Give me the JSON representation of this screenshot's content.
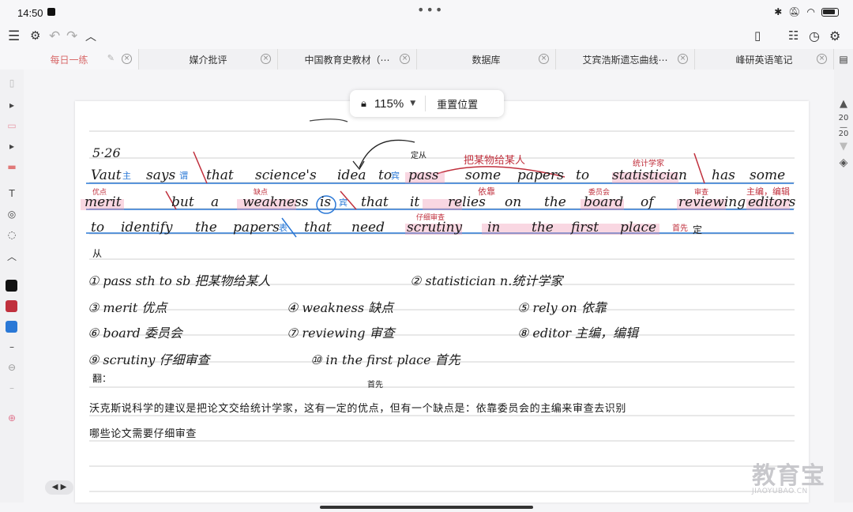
{
  "status": {
    "time": "14:50"
  },
  "tabs": [
    {
      "label": "每日一练"
    },
    {
      "label": "媒介批评"
    },
    {
      "label": "中国教育史教材（⋯"
    },
    {
      "label": "数据库"
    },
    {
      "label": "艾宾浩斯遗忘曲线⋯"
    },
    {
      "label": "峰研英语笔记"
    }
  ],
  "zoom": {
    "value": "115%",
    "reset_label": "重置位置"
  },
  "pager": {
    "current": "20",
    "total": "20"
  },
  "note": {
    "date": "5·26",
    "sentence": {
      "w1": "Vaut",
      "w2": "says",
      "w3": "that",
      "w4": "science's",
      "w5": "idea",
      "w6": "to",
      "w7": "pass",
      "w8": "some",
      "w9": "papers",
      "w10": "to",
      "w11": "statistician",
      "w12": "has",
      "w13": "some",
      "w14": "merit",
      "w15": "but",
      "w16": "a",
      "w17": "weakness",
      "w18": "is",
      "w19": "that",
      "w20": "it",
      "w21": "relies",
      "w22": "on",
      "w23": "the",
      "w24": "board",
      "w25": "of",
      "w26": "reviewing",
      "w27": "editors",
      "w28": "to",
      "w29": "identify",
      "w30": "the",
      "w31": "papers",
      "w32": "that",
      "w33": "need",
      "w34": "scrutiny",
      "w35": "in",
      "w36": "the",
      "w37": "first",
      "w38": "place"
    },
    "marks": {
      "zhu": "主",
      "wei": "谓",
      "bin": "宾",
      "ding": "定从",
      "pass_gloss": "把某物给某人",
      "stat_gloss": "统计学家",
      "merit_gloss": "优点",
      "weak_gloss": "缺点",
      "is_gloss": "宾",
      "relies_gloss": "依靠",
      "board_gloss": "委员会",
      "review_gloss": "审查",
      "editors_gloss": "主编，编辑",
      "scrut_gloss": "仔细审查",
      "biao": "表",
      "first_gloss": "首先",
      "ding2": "定",
      "cong": "从"
    },
    "vocab": [
      "① pass sth to sb 把某物给某人",
      "② statistician n.统计学家",
      "③ merit 优点",
      "④ weakness 缺点",
      "⑤ rely on 依靠",
      "⑥ board 委员会",
      "⑦ reviewing 审查",
      "⑧ editor 主编，编辑",
      "⑨ scrutiny 仔细审查",
      "⑩ in the first place 首先",
      "翻：",
      "首先"
    ],
    "translation_1": "沃克斯说科学的建议是把论文交给统计学家，这有一定的优点，但有一个缺点是：依靠委员会的主编来审查去识别",
    "translation_2": "哪些论文需要仔细审查"
  },
  "watermark": {
    "big": "教育宝",
    "small": "JIAOYUBAO.CN"
  },
  "colors": {
    "red_ink": "#c0303d",
    "blue_ink": "#2a78d6",
    "highlight": "#f3bfd0"
  }
}
